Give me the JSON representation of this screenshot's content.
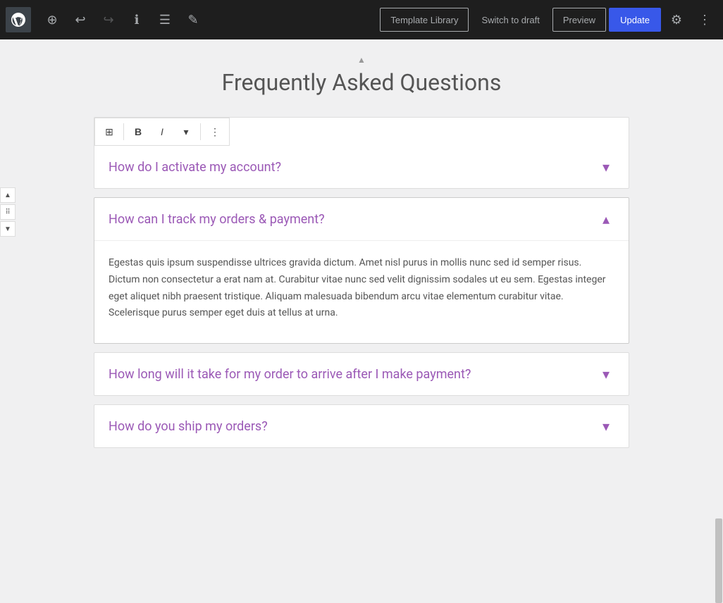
{
  "toolbar": {
    "template_library_label": "Template Library",
    "switch_draft_label": "Switch to draft",
    "preview_label": "Preview",
    "update_label": "Update"
  },
  "page": {
    "title": "Frequently Asked Questions"
  },
  "faq_items": [
    {
      "id": "faq1",
      "question": "How do I activate my account?",
      "expanded": false,
      "toggle_icon": "▾",
      "content": ""
    },
    {
      "id": "faq2",
      "question": "How can I track my orders & payment?",
      "expanded": true,
      "toggle_icon": "▴",
      "content": "Egestas quis ipsum suspendisse ultrices gravida dictum. Amet nisl purus in mollis nunc sed id semper risus. Dictum non consectetur a erat nam at. Curabitur vitae nunc sed velit dignissim sodales ut eu sem. Egestas integer eget aliquet nibh praesent tristique. Aliquam malesuada bibendum arcu vitae elementum curabitur vitae. Scelerisque purus semper eget duis at tellus at urna."
    },
    {
      "id": "faq3",
      "question": "How long will it take for my order to arrive after I make payment?",
      "expanded": false,
      "toggle_icon": "▾",
      "content": ""
    },
    {
      "id": "faq4",
      "question": "How do you ship my orders?",
      "expanded": false,
      "toggle_icon": "▾",
      "content": ""
    }
  ],
  "inline_toolbar": {
    "table_icon": "⊞",
    "bold_label": "B",
    "italic_label": "I",
    "dropdown_icon": "▾",
    "more_icon": "⋮"
  },
  "icons": {
    "add": "⊕",
    "undo": "↩",
    "redo": "↪",
    "info": "ℹ",
    "list": "≡",
    "edit": "✎",
    "settings": "⚙",
    "more_vertical": "⋮",
    "up_arrow": "▲",
    "down_arrow": "▼",
    "drag": "⠿"
  }
}
